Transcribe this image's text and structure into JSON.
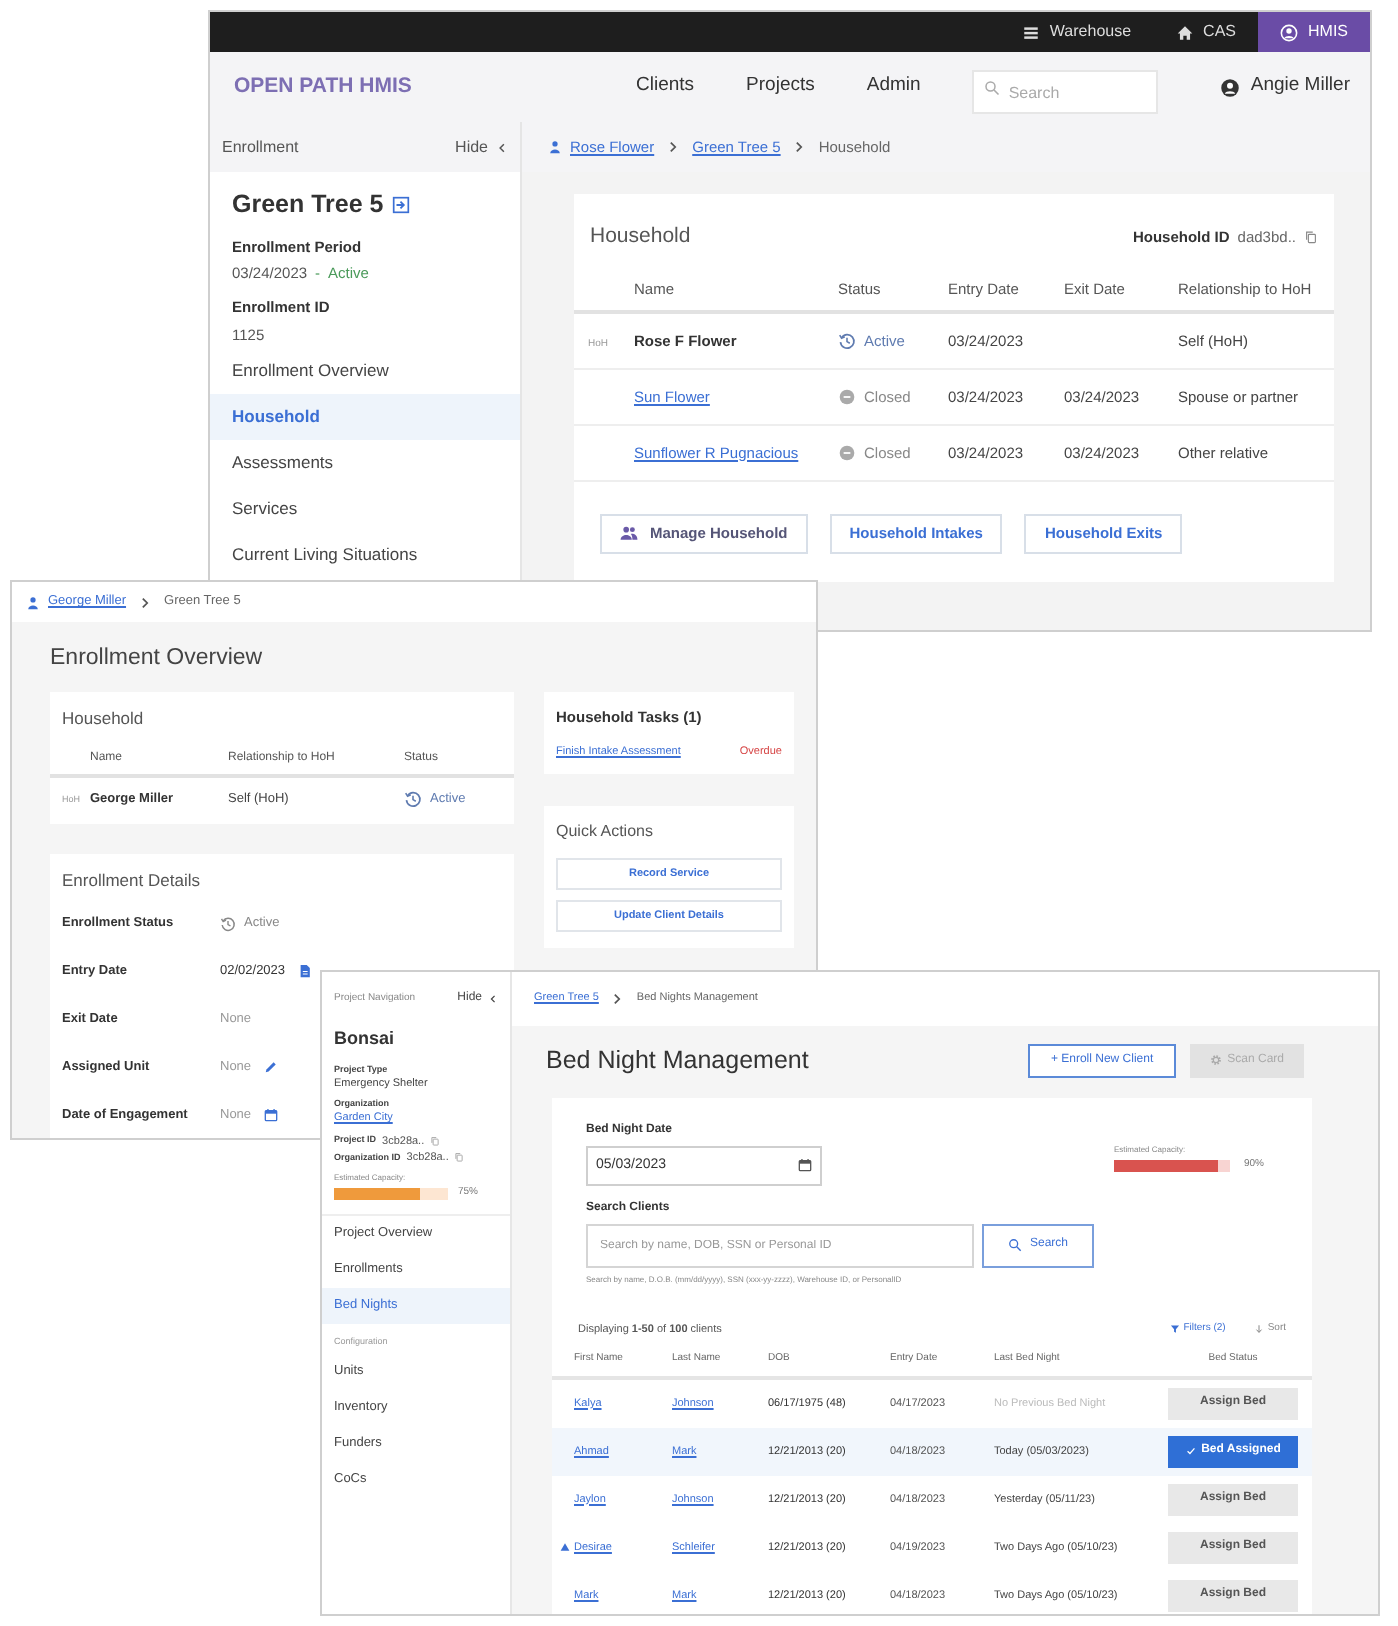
{
  "household_window": {
    "top_bar": [
      {
        "label": "Warehouse",
        "selected": false
      },
      {
        "label": "CAS",
        "selected": false
      },
      {
        "label": "HMIS",
        "selected": true
      }
    ],
    "brand": "OPEN PATH HMIS",
    "nav": [
      "Clients",
      "Projects",
      "Admin"
    ],
    "search": {
      "placeholder": "Search"
    },
    "user": "Angie Miller",
    "sidebar": {
      "title": "Enrollment",
      "hide": "Hide",
      "project": "Green Tree 5",
      "period_label": "Enrollment Period",
      "period_value": "03/24/2023",
      "period_separator": "-",
      "period_status": "Active",
      "id_label": "Enrollment ID",
      "id_value": "1125",
      "items": [
        {
          "label": "Enrollment Overview",
          "selected": false
        },
        {
          "label": "Household",
          "selected": true
        },
        {
          "label": "Assessments",
          "selected": false
        },
        {
          "label": "Services",
          "selected": false
        },
        {
          "label": "Current Living Situations",
          "selected": false
        }
      ]
    },
    "breadcrumb": [
      {
        "label": "Rose Flower",
        "kind": "person"
      },
      {
        "label": "Green Tree 5",
        "kind": "link"
      },
      {
        "label": "Household",
        "kind": "current"
      }
    ],
    "household": {
      "title": "Household",
      "id_label": "Household ID",
      "id_value": "dad3bd..",
      "columns": [
        "Name",
        "Status",
        "Entry Date",
        "Exit Date",
        "Relationship to HoH"
      ],
      "rows": [
        {
          "kind": "hoh",
          "badge": "HoH",
          "name": "Rose F Flower",
          "status": "Active",
          "active": true,
          "entry": "03/24/2023",
          "relationship": "Self (HoH)"
        },
        {
          "kind": "member",
          "name": "Sun Flower",
          "status": "Closed",
          "active": false,
          "entry": "03/24/2023",
          "exit": "03/24/2023",
          "relationship": "Spouse or partner"
        },
        {
          "kind": "member",
          "name": "Sunflower R Pugnacious",
          "status": "Closed",
          "active": false,
          "entry": "03/24/2023",
          "exit": "03/24/2023",
          "relationship": "Other relative"
        }
      ],
      "buttons": [
        "Manage Household",
        "Household Intakes",
        "Household Exits"
      ]
    }
  },
  "overview_window": {
    "breadcrumb": [
      {
        "label": "George Miller",
        "kind": "person"
      },
      {
        "label": "Green Tree 5",
        "kind": "current"
      }
    ],
    "title": "Enrollment Overview",
    "household": {
      "title": "Household",
      "columns": [
        "Name",
        "Relationship to HoH",
        "Status"
      ],
      "rows": [
        {
          "kind": "hoh",
          "badge": "HoH",
          "name": "George Miller",
          "relationship": "Self (HoH)",
          "status": "Active",
          "active": true
        }
      ]
    },
    "details": {
      "title": "Enrollment Details",
      "fields": [
        {
          "label": "Enrollment Status",
          "value": "Active",
          "kind": "status",
          "muted": true
        },
        {
          "label": "Entry Date",
          "value": "02/02/2023",
          "kind": "document",
          "muted": false
        },
        {
          "label": "Exit Date",
          "value": "None",
          "kind": "plain",
          "muted": true
        },
        {
          "label": "Assigned Unit",
          "value": "None",
          "kind": "edit",
          "muted": true
        },
        {
          "label": "Date of Engagement",
          "value": "None",
          "kind": "calendar",
          "muted": true
        }
      ]
    },
    "tasks": {
      "title": "Household Tasks (1)",
      "items": [
        {
          "label": "Finish Intake Assessment",
          "status": "Overdue"
        }
      ]
    },
    "quick_actions": {
      "title": "Quick Actions",
      "buttons": [
        "Record Service",
        "Update Client Details"
      ]
    }
  },
  "bed_nights_window": {
    "sidebar": {
      "title": "Project Navigation",
      "hide": "Hide",
      "project": "Bonsai",
      "fields": [
        {
          "label": "Project Type",
          "value": "Emergency Shelter",
          "kind": "text"
        },
        {
          "label": "Organization",
          "value": "Garden City",
          "kind": "link"
        }
      ],
      "ids": [
        {
          "label": "Project ID",
          "value": "3cb28a.."
        },
        {
          "label": "Organization ID",
          "value": "3cb28a.."
        }
      ],
      "capacity": {
        "label": "Estimated Capacity:",
        "level": 0.75,
        "reading": "75%"
      },
      "items": [
        {
          "label": "Project Overview",
          "selected": false
        },
        {
          "label": "Enrollments",
          "selected": false
        },
        {
          "label": "Bed Nights",
          "selected": true
        }
      ],
      "section": "Configuration",
      "config_items": [
        {
          "label": "Units",
          "selected": false
        },
        {
          "label": "Inventory",
          "selected": false
        },
        {
          "label": "Funders",
          "selected": false
        },
        {
          "label": "CoCs",
          "selected": false
        }
      ]
    },
    "breadcrumb": [
      {
        "label": "Green Tree 5",
        "kind": "link"
      },
      {
        "label": "Bed Nights Management",
        "kind": "current"
      }
    ],
    "title": "Bed Night Management",
    "actions": [
      {
        "label": "+ Enroll New Client",
        "disabled": false
      },
      {
        "label": "Scan Card",
        "disabled": true
      }
    ],
    "date": {
      "label": "Bed Night Date",
      "value": "05/03/2023"
    },
    "capacity": {
      "label": "Estimated Capacity:",
      "level": 0.9,
      "reading": "90%"
    },
    "search": {
      "label": "Search Clients",
      "placeholder": "Search by name, DOB, SSN or Personal ID",
      "hint": "Search by name, D.O.B. (mm/dd/yyyy), SSN (xxx-yy-zzzz), Warehouse ID, or PersonalID",
      "button": "Search"
    },
    "list": {
      "summary": "Displaying **1-50** of **100** clients",
      "filters": "Filters (2)",
      "sort": "Sort",
      "columns": [
        "First Name",
        "Last Name",
        "DOB",
        "Entry Date",
        "Last Bed Night",
        "Bed Status"
      ],
      "rows": [
        {
          "first": "Kalya",
          "last": "Johnson",
          "dob": "06/17/1975 (48)",
          "entry": "04/17/2023",
          "last_bed_night": "No Previous Bed Night",
          "muted": true,
          "flagged": false,
          "selected": false,
          "assigned": false,
          "bed": "Assign Bed"
        },
        {
          "first": "Ahmad",
          "last": "Mark",
          "dob": "12/21/2013 (20)",
          "entry": "04/18/2023",
          "last_bed_night": "Today (05/03/2023)",
          "muted": false,
          "flagged": false,
          "selected": true,
          "assigned": true,
          "bed": "Bed Assigned"
        },
        {
          "first": "Jaylon",
          "last": "Johnson",
          "dob": "12/21/2013 (20)",
          "entry": "04/18/2023",
          "last_bed_night": "Yesterday (05/11/23)",
          "muted": false,
          "flagged": false,
          "selected": false,
          "assigned": false,
          "bed": "Assign Bed"
        },
        {
          "first": "Desirae",
          "last": "Schleifer",
          "dob": "12/21/2013 (20)",
          "entry": "04/19/2023",
          "last_bed_night": "Two Days Ago (05/10/23)",
          "muted": false,
          "flagged": true,
          "selected": false,
          "assigned": false,
          "bed": "Assign Bed"
        },
        {
          "first": "Mark",
          "last": "Mark",
          "dob": "12/21/2013 (20)",
          "entry": "04/18/2023",
          "last_bed_night": "Two Days Ago (05/10/23)",
          "muted": false,
          "flagged": false,
          "selected": false,
          "assigned": false,
          "bed": "Assign Bed"
        }
      ]
    }
  }
}
